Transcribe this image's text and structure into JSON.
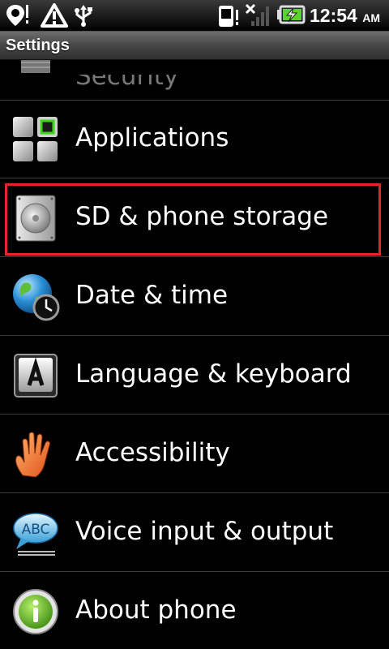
{
  "status_bar": {
    "time": "12:54",
    "ampm": "AM"
  },
  "title_bar": {
    "title": "Settings"
  },
  "settings_list": {
    "items": [
      {
        "label": "Security",
        "icon": "security-icon"
      },
      {
        "label": "Applications",
        "icon": "applications-icon"
      },
      {
        "label": "SD & phone storage",
        "icon": "storage-icon",
        "highlighted": true
      },
      {
        "label": "Date & time",
        "icon": "date-time-icon"
      },
      {
        "label": "Language & keyboard",
        "icon": "language-keyboard-icon"
      },
      {
        "label": "Accessibility",
        "icon": "accessibility-hand-icon"
      },
      {
        "label": "Voice input & output",
        "icon": "voice-abc-bubble-icon"
      },
      {
        "label": "About phone",
        "icon": "info-icon"
      }
    ]
  },
  "colors": {
    "highlight": "#e5252c",
    "battery_charge": "#5cd32c"
  }
}
